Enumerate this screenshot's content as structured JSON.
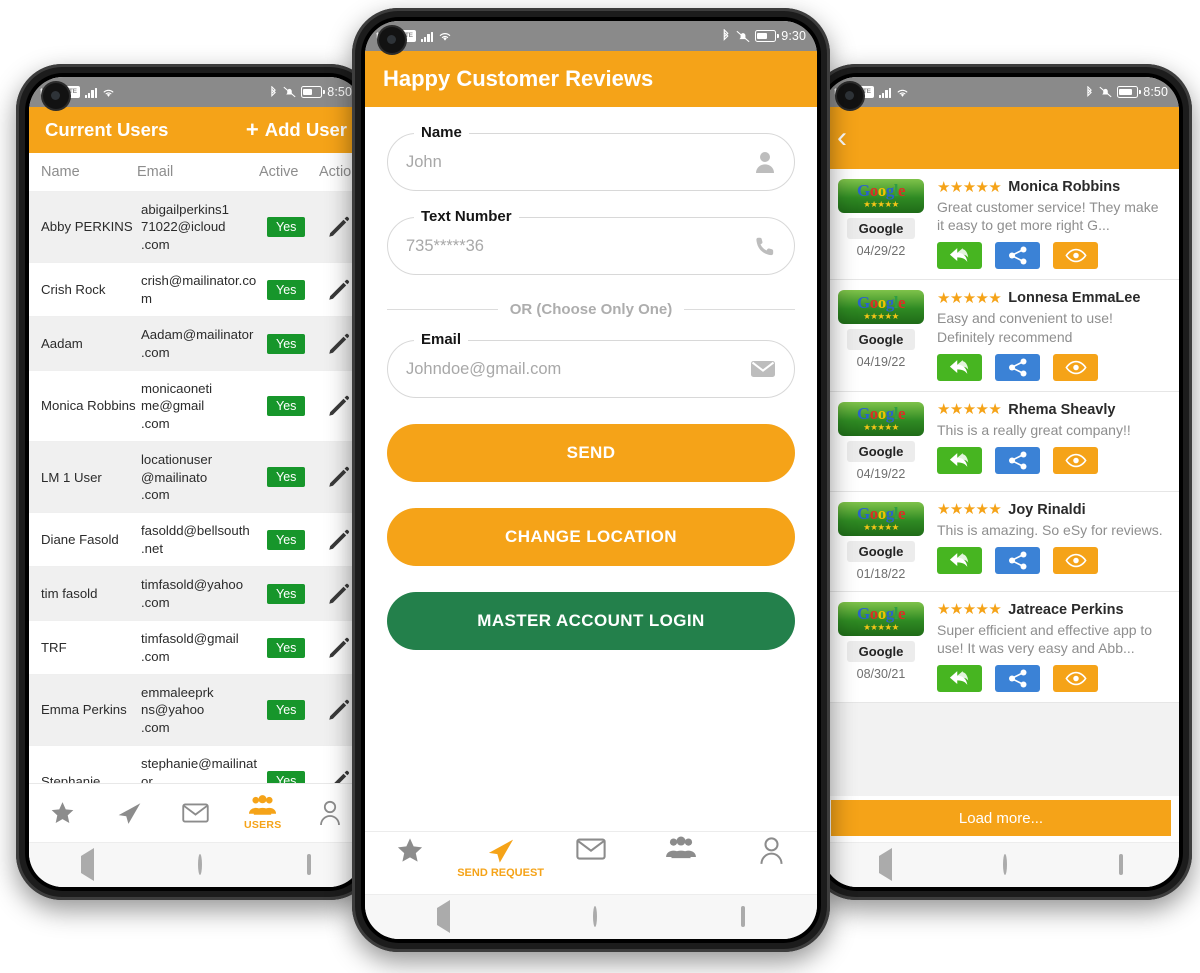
{
  "status_bars": {
    "left": {
      "carrier": "tel",
      "volte": "VoLTE",
      "time": "8:50"
    },
    "center": {
      "carrier": "tel",
      "volte": "VoLTE",
      "time": "9:30"
    },
    "right": {
      "carrier": "tel",
      "volte": "VoLTE",
      "time": "8:50"
    }
  },
  "colors": {
    "brand_orange": "#F5A318",
    "green_yes": "#17962b",
    "green_login": "#23804B",
    "action_green": "#47B521",
    "action_blue": "#3B82D6",
    "statusbar_gray": "#8a8a8a"
  },
  "left_phone": {
    "appbar": {
      "title": "Current Users",
      "add_user_label": "Add User",
      "plus": "+"
    },
    "table": {
      "columns": [
        "Name",
        "Email",
        "Active",
        "Actions"
      ],
      "rows": [
        {
          "name": "Abby PERKINS",
          "email": "abigailperkins171022@icloud.com",
          "active": "Yes"
        },
        {
          "name": "Crish Rock",
          "email": "crish@mailinator.com",
          "active": "Yes"
        },
        {
          "name": "Aadam",
          "email": "Aadam@mailinator.com",
          "active": "Yes"
        },
        {
          "name": "Monica Robbins",
          "email": "monicaonetime@gmail.com",
          "active": "Yes"
        },
        {
          "name": "LM 1 User",
          "email": "locationuser@mailinato.com",
          "active": "Yes"
        },
        {
          "name": "Diane Fasold",
          "email": "fasoldd@bellsouth.net",
          "active": "Yes"
        },
        {
          "name": "tim fasold",
          "email": "timfasold@yahoo.com",
          "active": "Yes"
        },
        {
          "name": "TRF",
          "email": "timfasold@gmail.com",
          "active": "Yes"
        },
        {
          "name": "Emma Perkins",
          "email": "emmaleeprkns@yahoo.com",
          "active": "Yes"
        },
        {
          "name": "Stephanie",
          "email": "stephanie@mailinator.com",
          "active": "Yes"
        }
      ]
    },
    "bottom_nav": [
      {
        "icon": "star-icon",
        "label": "",
        "active": false
      },
      {
        "icon": "send-paper-plane-icon",
        "label": "",
        "active": false
      },
      {
        "icon": "envelope-icon",
        "label": "",
        "active": false
      },
      {
        "icon": "users-group-icon",
        "label": "USERS",
        "active": true
      },
      {
        "icon": "person-icon",
        "label": "",
        "active": false
      }
    ]
  },
  "center_phone": {
    "appbar": {
      "title": "Happy Customer Reviews"
    },
    "form": {
      "name": {
        "label": "Name",
        "placeholder": "John",
        "icon": "person-icon"
      },
      "text_number": {
        "label": "Text Number",
        "placeholder": "735*****36",
        "icon": "phone-icon"
      },
      "or_separator": "OR (Choose Only One)",
      "email": {
        "label": "Email",
        "placeholder": "Johndoe@gmail.com",
        "icon": "envelope-icon"
      }
    },
    "buttons": {
      "send": "SEND",
      "change_location": "CHANGE LOCATION",
      "master_login": "MASTER ACCOUNT LOGIN"
    },
    "bottom_nav": [
      {
        "icon": "star-icon",
        "label": "",
        "active": false
      },
      {
        "icon": "send-paper-plane-icon",
        "label": "SEND REQUEST",
        "active": true
      },
      {
        "icon": "envelope-icon",
        "label": "",
        "active": false
      },
      {
        "icon": "users-group-icon",
        "label": "",
        "active": false
      },
      {
        "icon": "person-outline-icon",
        "label": "",
        "active": false
      }
    ]
  },
  "right_phone": {
    "appbar": {
      "back": "‹"
    },
    "reviews": [
      {
        "source": "Google",
        "date": "04/29/22",
        "stars": 5,
        "name": "Monica Robbins",
        "text": "Great customer service! They make it easy to get more right G..."
      },
      {
        "source": "Google",
        "date": "04/19/22",
        "stars": 5,
        "name": "Lonnesa EmmaLee",
        "text": "Easy and convenient to use! Definitely recommend"
      },
      {
        "source": "Google",
        "date": "04/19/22",
        "stars": 5,
        "name": "Rhema Sheavly",
        "text": "This is a really great company!!"
      },
      {
        "source": "Google",
        "date": "01/18/22",
        "stars": 5,
        "name": "Joy Rinaldi",
        "text": "This is amazing. So eSy for reviews."
      },
      {
        "source": "Google",
        "date": "08/30/21",
        "stars": 5,
        "name": "Jatreace Perkins",
        "text": "Super efficient and effective app to use! It was very easy and Abb..."
      }
    ],
    "card_actions": [
      {
        "icon": "reply-icon",
        "color": "#47B521"
      },
      {
        "icon": "share-icon",
        "color": "#3B82D6"
      },
      {
        "icon": "eye-icon",
        "color": "#F5A318"
      }
    ],
    "load_more": "Load more...",
    "google_logo_letters": [
      "G",
      "o",
      "o",
      "g",
      "l",
      "e"
    ]
  }
}
